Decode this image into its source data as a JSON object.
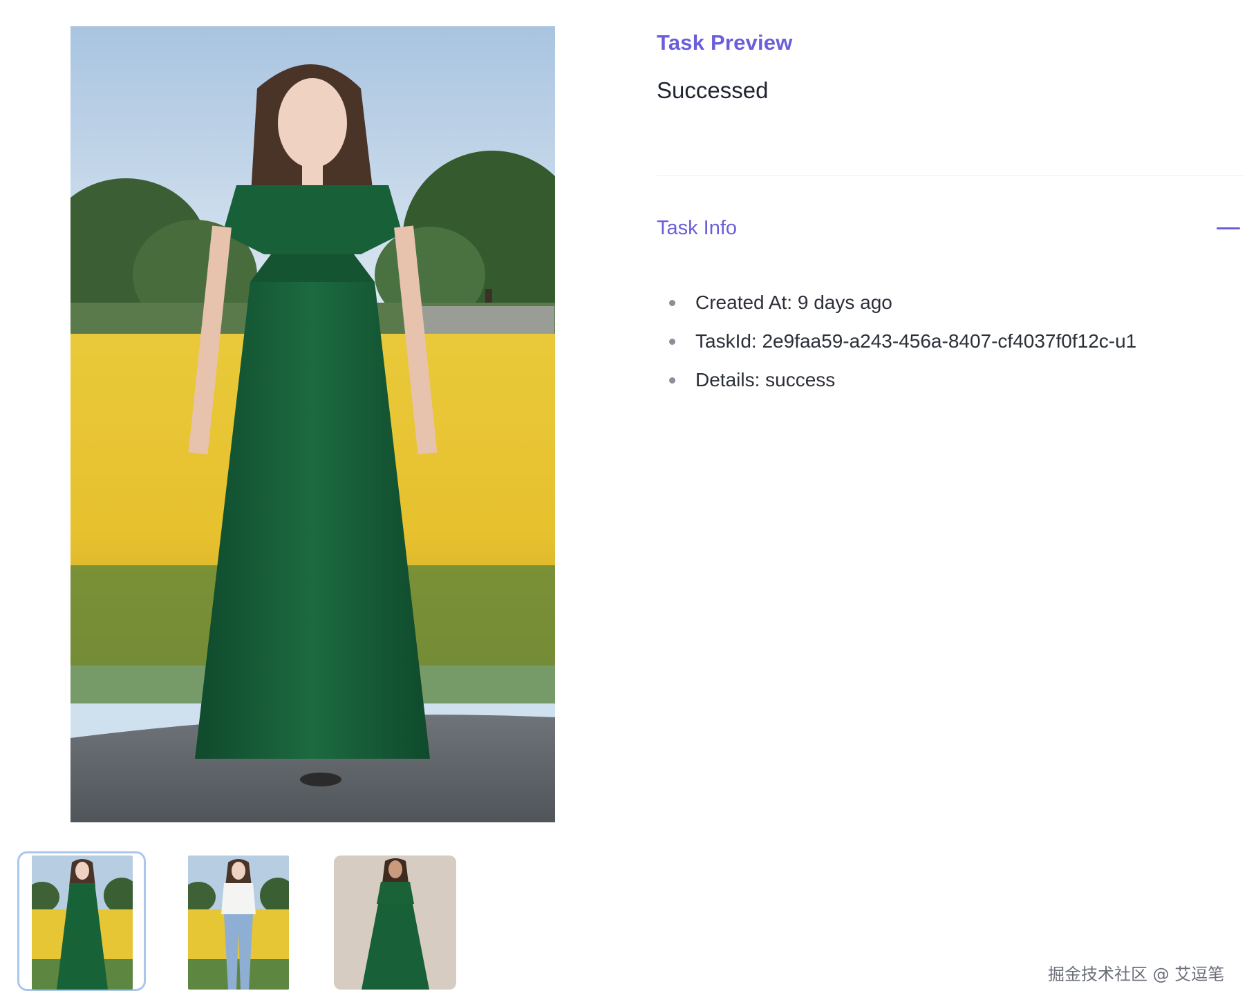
{
  "preview": {
    "main_image": "Model in a long green V-neck chiffon dress standing in a field of yellow flowers",
    "thumbnails": [
      {
        "description": "Green dress in yellow flower field",
        "selected": true
      },
      {
        "description": "White t-shirt and blue jeans in yellow flower field",
        "selected": false
      },
      {
        "description": "Green dress on beige studio background",
        "selected": false
      }
    ]
  },
  "panel": {
    "title": "Task Preview",
    "status": "Successed",
    "info_section": {
      "title": "Task Info",
      "collapse_icon": "minus-icon",
      "items": [
        {
          "label": "Created At: 9 days ago"
        },
        {
          "label": "TaskId: 2e9faa59-a243-456a-8407-cf4037f0f12c-u1"
        },
        {
          "label": "Details: success"
        }
      ]
    }
  },
  "watermark": "掘金技术社区 @ 艾逗笔",
  "colors": {
    "accent": "#6a5ed9",
    "thumb_selected_border": "#a9c6ee",
    "divider": "#eceef2"
  }
}
